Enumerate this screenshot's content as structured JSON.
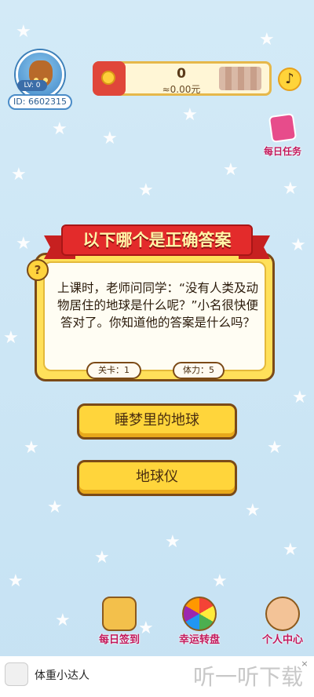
{
  "profile": {
    "level": "LV: 0",
    "id_text": "ID: 6602315"
  },
  "wallet": {
    "coins": "0",
    "cash": "≈0.00元"
  },
  "daily_task": {
    "label": "每日任务"
  },
  "question": {
    "title": "以下哪个是正确答案",
    "text": "上课时，老师问同学：“没有人类及动物居住的地球是什么呢？”小名很快便答对了。你知道他的答案是什么吗？",
    "level_label": "关卡：1",
    "stamina_label": "体力：5"
  },
  "answers": [
    "睡梦里的地球",
    "地球仪"
  ],
  "nav": {
    "checkin": "每日签到",
    "wheel": "幸运转盘",
    "profile": "个人中心"
  },
  "ad": {
    "title": "体重小达人",
    "close": "×",
    "watermark": "听一听下载"
  },
  "colors": {
    "accent": "#ffd53b",
    "ribbon": "#e32b2b",
    "background": "#cfe8f6",
    "label": "#c2185b"
  }
}
